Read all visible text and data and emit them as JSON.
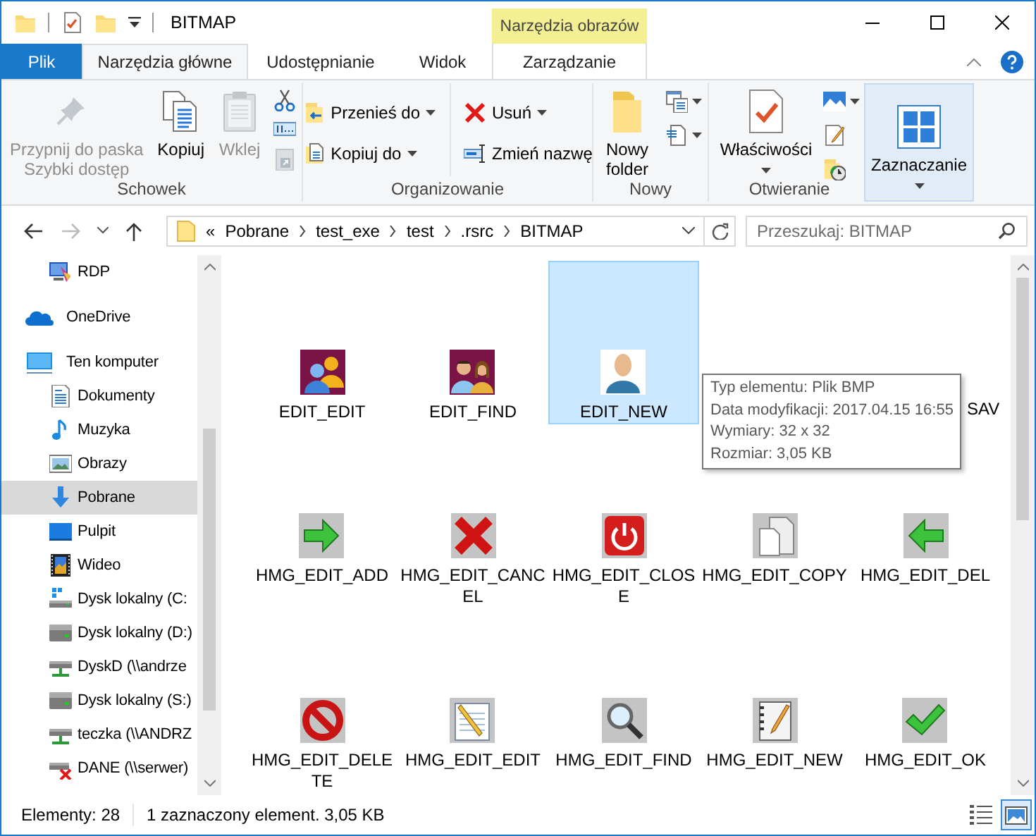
{
  "window": {
    "title": "BITMAP",
    "context_group": "Narzędzia obrazów"
  },
  "tabs": [
    {
      "label": "Plik",
      "kind": "file",
      "selected": false
    },
    {
      "label": "Narzędzia główne",
      "kind": "normal",
      "selected": true
    },
    {
      "label": "Udostępnianie",
      "kind": "normal",
      "selected": false
    },
    {
      "label": "Widok",
      "kind": "normal",
      "selected": false
    },
    {
      "label": "Zarządzanie",
      "kind": "context",
      "selected": false
    }
  ],
  "ribbon": {
    "groups": [
      {
        "label": "Schowek",
        "commands": [
          {
            "kind": "large",
            "label": "Przypnij do paska Szybki dostęp",
            "disabled": true
          },
          {
            "kind": "large",
            "label": "Kopiuj",
            "disabled": false
          },
          {
            "kind": "large",
            "label": "Wklej",
            "disabled": true
          },
          {
            "kind": "stack",
            "items": [
              {
                "kind": "icon",
                "disabled": false
              },
              {
                "kind": "icon",
                "disabled": false
              },
              {
                "kind": "icon",
                "disabled": true
              }
            ]
          }
        ]
      },
      {
        "label": "Organizowanie",
        "commands": [
          {
            "kind": "stack",
            "items": [
              {
                "kind": "small",
                "label": "Przenieś do",
                "dropdown": true,
                "disabled": false
              },
              {
                "kind": "small",
                "label": "Kopiuj do",
                "dropdown": true,
                "disabled": false
              }
            ]
          },
          {
            "kind": "stack",
            "items": [
              {
                "kind": "small",
                "label": "Usuń",
                "dropdown": true,
                "disabled": false
              },
              {
                "kind": "small",
                "label": "Zmień nazwę",
                "dropdown": false,
                "disabled": false
              }
            ]
          }
        ]
      },
      {
        "label": "Nowy",
        "commands": [
          {
            "kind": "large",
            "label": "Nowy folder",
            "disabled": false
          },
          {
            "kind": "stack",
            "items": [
              {
                "kind": "icon",
                "dropdown": true,
                "disabled": false
              },
              {
                "kind": "icon",
                "dropdown": true,
                "disabled": false
              }
            ]
          }
        ]
      },
      {
        "label": "Otwieranie",
        "commands": [
          {
            "kind": "large",
            "label": "Właściwości",
            "dropdown": true,
            "disabled": false
          },
          {
            "kind": "stack",
            "items": [
              {
                "kind": "icon",
                "dropdown": true,
                "disabled": false
              },
              {
                "kind": "icon",
                "dropdown": false,
                "disabled": false
              },
              {
                "kind": "icon",
                "dropdown": false,
                "disabled": false
              }
            ]
          }
        ]
      },
      {
        "commands": [
          {
            "kind": "large",
            "label": "Zaznaczanie",
            "dropdown": true,
            "highlighted": true,
            "disabled": false
          }
        ]
      }
    ]
  },
  "address": {
    "overflow_mark": "«",
    "path": [
      "Pobrane",
      "test_exe",
      "test",
      ".rsrc",
      "BITMAP"
    ]
  },
  "search": {
    "placeholder": "Przeszukaj: BITMAP"
  },
  "nav": {
    "items": [
      {
        "children": [
          {
            "label": "RDP",
            "selected": false
          }
        ]
      },
      {
        "label": "OneDrive",
        "selected": false
      },
      {
        "label": "Ten komputer",
        "selected": false,
        "children": [
          {
            "label": "Dokumenty",
            "selected": false
          },
          {
            "label": "Muzyka",
            "selected": false
          },
          {
            "label": "Obrazy",
            "selected": false
          },
          {
            "label": "Pobrane",
            "selected": true
          },
          {
            "label": "Pulpit",
            "selected": false
          },
          {
            "label": "Wideo",
            "selected": false
          },
          {
            "label": "Dysk lokalny (C:",
            "selected": false
          },
          {
            "label": "Dysk lokalny (D:)",
            "selected": false
          },
          {
            "label": "DyskD (\\\\andrze",
            "selected": false
          },
          {
            "label": "Dysk lokalny (S:)",
            "selected": false
          },
          {
            "label": "teczka (\\\\ANDRZ",
            "selected": false
          },
          {
            "label": "DANE (\\\\serwer)",
            "selected": false
          }
        ]
      }
    ]
  },
  "files": {
    "rows": [
      [
        {
          "label": "EDIT_EDIT",
          "kind": "thumbnail",
          "selected": false
        },
        {
          "label": "EDIT_FIND",
          "kind": "thumbnail",
          "selected": false
        },
        {
          "label": "EDIT_NEW",
          "kind": "thumbnail",
          "selected": true
        },
        "",
        {
          "label": "SAV",
          "kind": "covered",
          "selected": false
        }
      ],
      [
        {
          "label": "HMG_EDIT_ADD",
          "kind": "thumbnail",
          "selected": false
        },
        {
          "label": "HMG_EDIT_CANCEL",
          "kind": "thumbnail",
          "selected": false
        },
        {
          "label": "HMG_EDIT_CLOSE",
          "kind": "thumbnail",
          "selected": false
        },
        {
          "label": "HMG_EDIT_COPY",
          "kind": "thumbnail",
          "selected": false
        },
        {
          "label": "HMG_EDIT_DEL",
          "kind": "thumbnail",
          "selected": false
        }
      ],
      [
        {
          "label": "HMG_EDIT_DELETE",
          "kind": "thumbnail",
          "selected": false
        },
        {
          "label": "HMG_EDIT_EDIT",
          "kind": "thumbnail",
          "selected": false
        },
        {
          "label": "HMG_EDIT_FIND",
          "kind": "thumbnail",
          "selected": false
        },
        {
          "label": "HMG_EDIT_NEW",
          "kind": "thumbnail",
          "selected": false
        },
        {
          "label": "HMG_EDIT_OK",
          "kind": "thumbnail",
          "selected": false
        }
      ]
    ]
  },
  "tooltip": {
    "lines": [
      "Typ elementu: Plik BMP",
      "Data modyfikacji: 2017.04.15 16:55",
      "Wymiary: 32 x 32",
      "Rozmiar: 3,05 KB"
    ]
  },
  "status_bar": {
    "count": "Elementy: 28",
    "selection": "1 zaznaczony element. 3,05 KB",
    "views": [
      {
        "selected": false
      },
      {
        "selected": true
      }
    ]
  }
}
